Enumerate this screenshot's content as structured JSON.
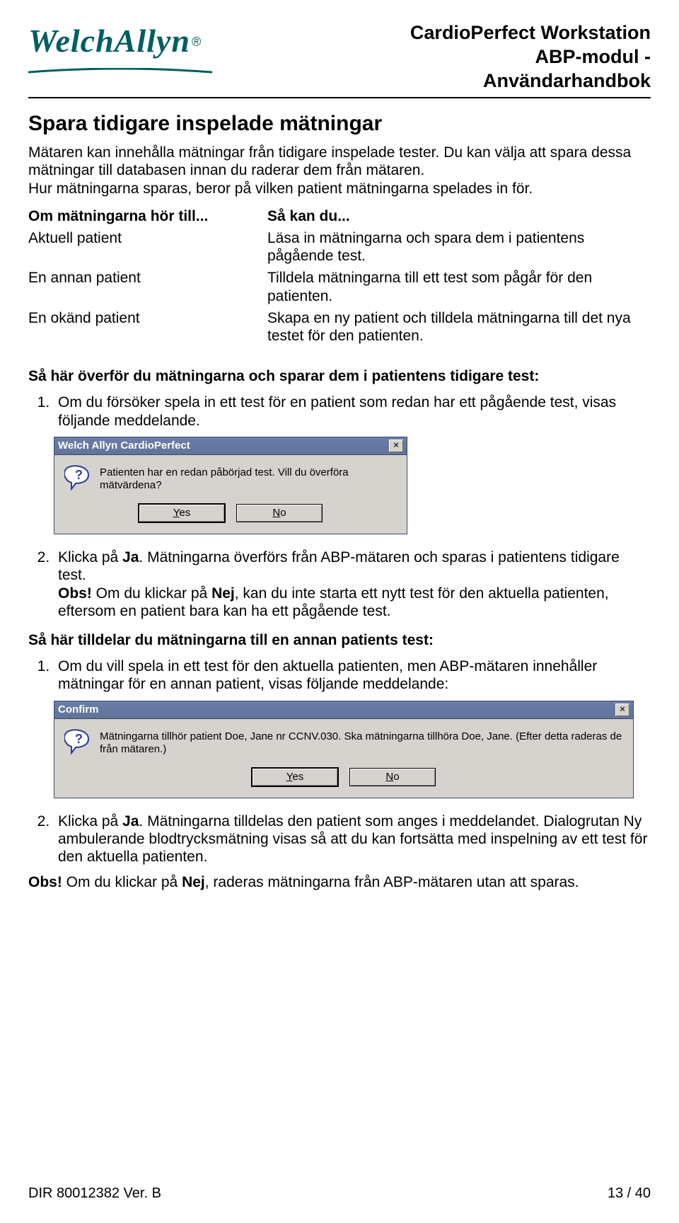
{
  "header": {
    "logo_text": "WelchAllyn",
    "title_line1": "CardioPerfect Workstation",
    "title_line2": "ABP-modul - Användarhandbok"
  },
  "h1": "Spara tidigare inspelade mätningar",
  "intro": "Mätaren kan innehålla mätningar från tidigare inspelade tester. Du kan välja att spara dessa mätningar till databasen innan du raderar dem från mätaren.\nHur mätningarna sparas, beror på vilken patient mätningarna spelades in för.",
  "table": {
    "h1": "Om mätningarna hör till...",
    "h2": "Så kan du...",
    "r1a": "Aktuell patient",
    "r1b": "Läsa in mätningarna och spara dem i patientens pågående test.",
    "r2a": "En annan patient",
    "r2b": "Tilldela mätningarna till ett test som pågår för den patienten.",
    "r3a": "En okänd patient",
    "r3b": "Skapa en ny patient och tilldela mätningarna till det nya testet för den patienten."
  },
  "section1": {
    "head": "Så här överför du mätningarna och sparar dem i patientens tidigare test:",
    "step1": "Om du försöker spela in ett test för en patient som redan har ett pågående test, visas följande meddelande.",
    "step2_a": "Klicka på ",
    "step2_b": ". Mätningarna överförs från ABP-mätaren och sparas i patientens tidigare test.",
    "ja": "Ja",
    "nej": "Nej",
    "obs_label": "Obs!",
    "obs_text": " Om du klickar på ",
    "obs_text2": ", kan du inte starta ett nytt test för den aktuella patienten, eftersom en patient bara kan ha ett pågående test."
  },
  "dialog1": {
    "title": "Welch Allyn CardioPerfect",
    "text": "Patienten har en redan påbörjad test. Vill du överföra mätvärdena?",
    "yes_u": "Y",
    "yes_rest": "es",
    "no_u": "N",
    "no_rest": "o"
  },
  "section2": {
    "head": "Så här tilldelar du mätningarna till en annan patients test:",
    "step1": "Om du vill spela in ett test för den aktuella patienten, men ABP-mätaren innehåller mätningar för en annan patient, visas följande meddelande:"
  },
  "dialog2": {
    "title": "Confirm",
    "text": "Mätningarna tillhör patient Doe, Jane nr CCNV.030. Ska mätningarna tillhöra Doe, Jane. (Efter detta raderas de från mätaren.)",
    "yes_u": "Y",
    "yes_rest": "es",
    "no_u": "N",
    "no_rest": "o"
  },
  "section2b": {
    "step2_a": "Klicka på ",
    "ja": "Ja",
    "step2_b": ". Mätningarna tilldelas den patient som anges i meddelandet. Dialogrutan Ny ambulerande blodtrycksmätning visas så att du kan fortsätta med inspelning av ett test för den aktuella patienten.",
    "obs_label": "Obs!",
    "obs_text": " Om du klickar på ",
    "nej": "Nej",
    "obs_text2": ", raderas mätningarna från ABP-mätaren utan att sparas."
  },
  "footer": {
    "left": "DIR 80012382 Ver. B",
    "right": "13 / 40"
  }
}
